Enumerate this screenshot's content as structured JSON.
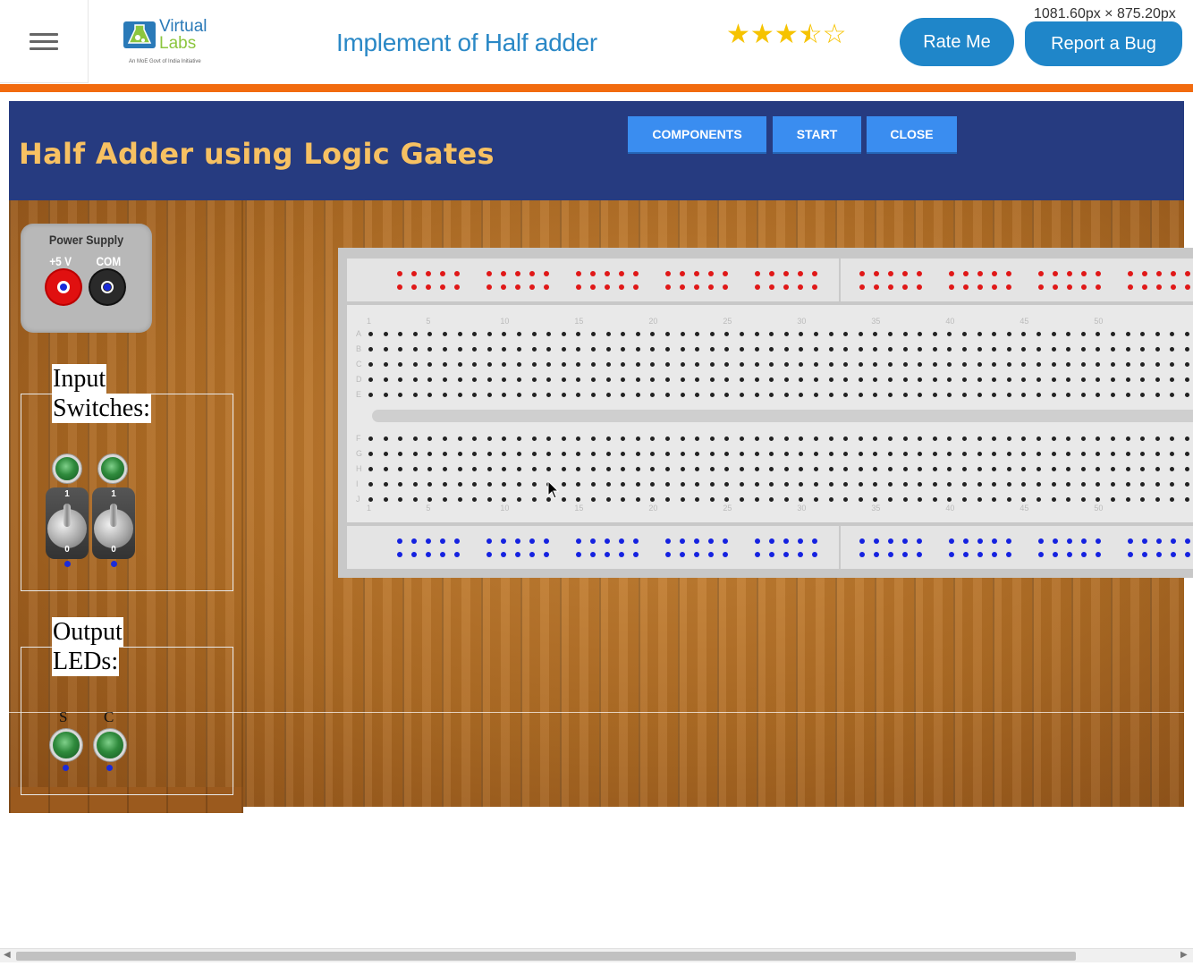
{
  "header": {
    "menu_icon": "hamburger-menu-icon",
    "logo": {
      "line1": "Virtual",
      "line2": "Labs",
      "tagline": "An MoE Govt of India Initiative"
    },
    "page_title": "Implement of Half adder",
    "rating": {
      "value": 3.5,
      "max": 5,
      "color": "#f6c300"
    },
    "rate_button": "Rate Me",
    "bug_button": "Report a Bug",
    "dimension_readout": "1081.60px × 875.20px",
    "accent": "#1f86c9",
    "rule_color": "#f26b0f"
  },
  "simulator": {
    "title": "Half Adder using Logic Gates",
    "buttons": {
      "components": "COMPONENTS",
      "start": "START",
      "close": "CLOSE"
    },
    "banner_color": "#263b80",
    "title_color": "#f7c162"
  },
  "power_supply": {
    "title": "Power Supply",
    "plus_label": "+5 V",
    "com_label": "COM",
    "plus_color": "#e01010",
    "com_color": "#2a2a2a"
  },
  "inputs": {
    "label_line1": "Input",
    "label_line2": "Switches:",
    "switch_top_mark": "1",
    "switch_bottom_mark": "0",
    "count": 2
  },
  "outputs": {
    "label_line1": "Output",
    "label_line2": "LEDs:",
    "leds": [
      {
        "tag": "S"
      },
      {
        "tag": "C"
      }
    ]
  },
  "breadboard": {
    "column_numbers": [
      "1",
      "5",
      "10",
      "15",
      "20",
      "25",
      "30",
      "35",
      "40",
      "45",
      "50"
    ],
    "row_letters_top": [
      "A",
      "B",
      "C",
      "D",
      "E"
    ],
    "row_letters_bottom": [
      "F",
      "G",
      "H",
      "I",
      "J"
    ],
    "top_rail_color": "#e01818",
    "bottom_rail_color": "#1522e0"
  }
}
